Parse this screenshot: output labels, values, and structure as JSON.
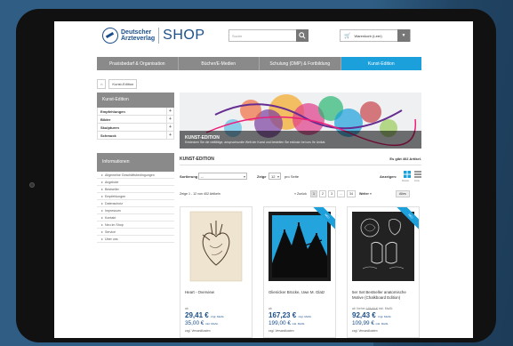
{
  "header": {
    "logo_line1": "Deutscher",
    "logo_line2": "Ärzteverlag",
    "logo_shop": "SHOP",
    "search_placeholder": "Suche",
    "cart_label": "Warenkorb (Leer)"
  },
  "nav": {
    "items": [
      "Praxisbedarf & Organisation",
      "Bücher/E-Medien",
      "Schulung (DMP) & Fortbildung",
      "Kunst-Edition"
    ],
    "active_index": 3
  },
  "breadcrumb": {
    "current": "Kunst-Edition"
  },
  "sidebar": {
    "category_title": "Kunst-Edition",
    "categories": [
      "Empfehlungen",
      "Bilder",
      "Skulpturen",
      "Schmuck"
    ],
    "info_title": "Informationen",
    "info_links": [
      "Allgemeine Geschäftsbedingungen",
      "Angebote",
      "Bestseller",
      "Empfehlungen",
      "Datenschutz",
      "Impressum",
      "Kontakt",
      "Neu im Shop",
      "Service",
      "Über uns"
    ]
  },
  "banner": {
    "title": "KUNST-EDITION",
    "subtitle": "Entdecken Sie die vielfältige, anspruchsvolle Welt der Kunst und bestellen Sie exklusiv bei uns Ihr Unikat."
  },
  "listing": {
    "title": "KUNST-EDITION",
    "count": "Es gibt 402 Artikel.",
    "sort_label": "Sortierung",
    "sort_value": "--",
    "show_label": "Zeige",
    "show_value": "12",
    "per_page": "pro Seite",
    "view_label": "Anzeigen:",
    "view_grid": "Raster",
    "view_list": "Liste",
    "range": "Zeige 1 - 12 von 402 Artikeln",
    "prev": "« Zurück",
    "pages": [
      "1",
      "2",
      "3",
      "...",
      "34"
    ],
    "current_page": "1",
    "next": "Weiter »",
    "filter_button": "Alles"
  },
  "products": [
    {
      "name": "Heart - Overview",
      "ab": "ab",
      "price_net": "29,41 €",
      "price_net_suffix": "zzgl. MwSt.",
      "price_gross": "35,00 €",
      "price_gross_suffix": "inkl. MwSt.",
      "shipping": "zzgl. Versandkosten",
      "ribbon": ""
    },
    {
      "name": "Glienicker Brücke, Uwe M. Glatz",
      "ab": "ab",
      "price_net": "167,23 €",
      "price_net_suffix": "zzgl. MwSt.",
      "price_gross": "199,00 €",
      "price_gross_suffix": "inkl. MwSt.",
      "shipping": "zzgl. Versandkosten",
      "ribbon": "NEU"
    },
    {
      "name": "5er Set Bestseller anatomische Motive (Chalkboard Edition)",
      "ab": "ab Vorher",
      "old_price": "178,00 €",
      "old_suffix": "inkl. MwSt.",
      "price_net": "92,43 €",
      "price_net_suffix": "zzgl. MwSt.",
      "price_gross": "109,99 €",
      "price_gross_suffix": "inkl. MwSt.",
      "shipping": "zzgl. Versandkosten",
      "ribbon": "NEU"
    }
  ],
  "colors": {
    "background": "#2f5d83",
    "accent": "#1ba0dc",
    "brand": "#1b4f8a",
    "nav_gray": "#8a8a8a"
  }
}
